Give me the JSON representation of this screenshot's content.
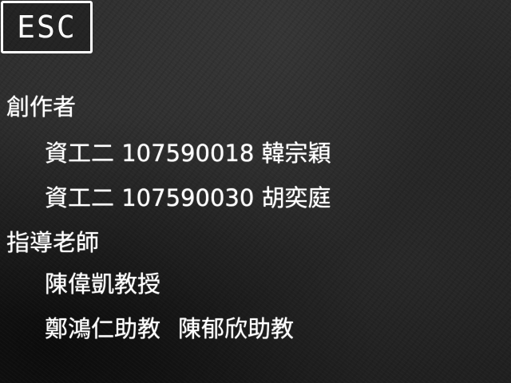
{
  "esc_button": {
    "label": "ESC"
  },
  "credits": {
    "creators_heading": "創作者",
    "creators": [
      {
        "dept": "資工二",
        "id": "107590018",
        "name": "韓宗穎"
      },
      {
        "dept": "資工二",
        "id": "107590030",
        "name": "胡奕庭"
      }
    ],
    "advisors_heading": "指導老師",
    "advisors": [
      "陳偉凱教授",
      "鄭鴻仁助教",
      "陳郁欣助教"
    ]
  },
  "colors": {
    "text": "#ffffff",
    "background": "#222222"
  }
}
